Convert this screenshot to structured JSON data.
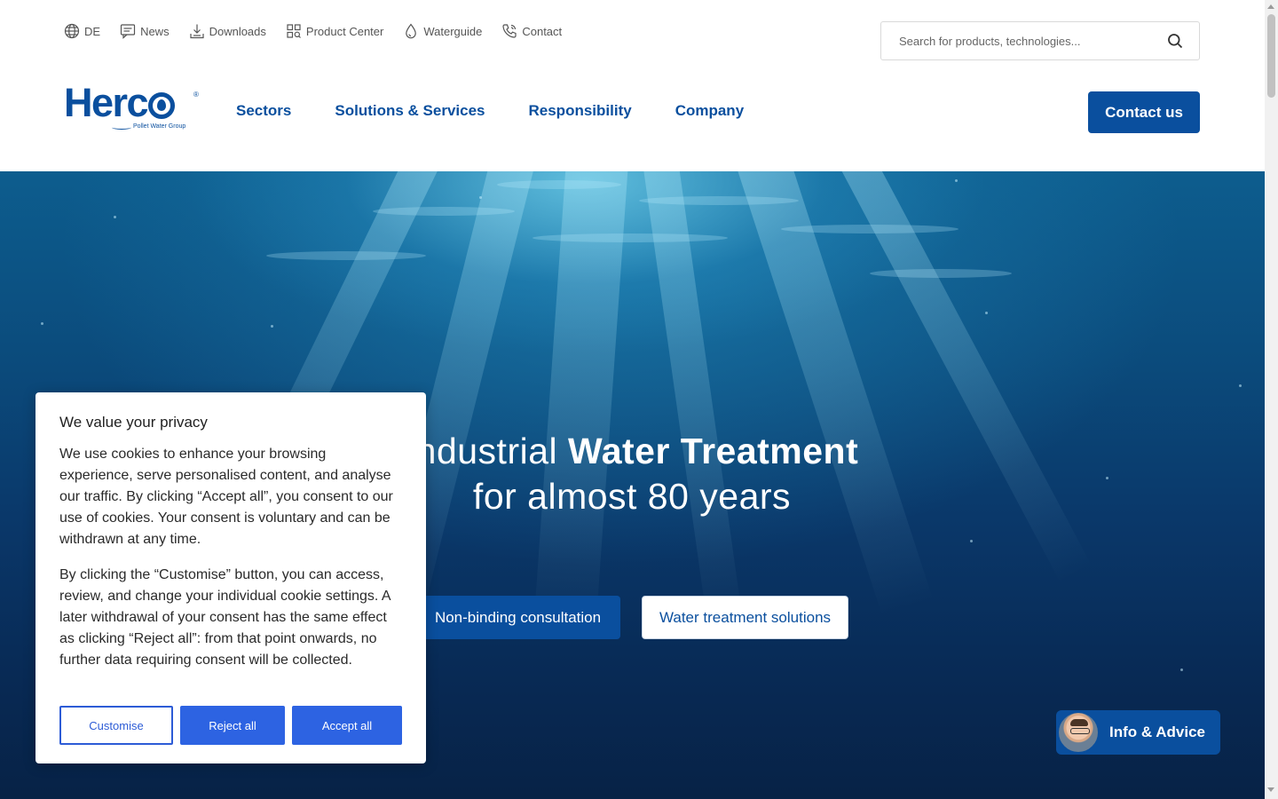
{
  "utility_nav": [
    {
      "label": "DE",
      "icon": "globe-icon"
    },
    {
      "label": "News",
      "icon": "chat-icon"
    },
    {
      "label": "Downloads",
      "icon": "download-icon"
    },
    {
      "label": "Product Center",
      "icon": "grid-search-icon"
    },
    {
      "label": "Waterguide",
      "icon": "water-drop-icon"
    },
    {
      "label": "Contact",
      "icon": "phone-icon"
    }
  ],
  "search": {
    "placeholder": "Search for products, technologies..."
  },
  "logo": {
    "word": "Herc",
    "tagline": "Pollet Water Group",
    "registered": "®"
  },
  "main_nav": [
    "Sectors",
    "Solutions & Services",
    "Responsibility",
    "Company"
  ],
  "contact_button": "Contact us",
  "hero": {
    "title_line1_prefix": "Industrial ",
    "title_line1_bold": "Water Treatment",
    "title_line2": "for almost 80 years",
    "primary_button": "Non-binding consultation",
    "secondary_button": "Water treatment solutions"
  },
  "info_widget": {
    "label": "Info & Advice"
  },
  "cookie_banner": {
    "title": "We value your privacy",
    "paragraph1": "We use cookies to enhance your browsing experience, serve personalised content, and analyse our traffic. By clicking “Accept all”, you consent to our use of cookies. Your consent is voluntary and can be withdrawn at any time.",
    "paragraph2": "By clicking the “Customise” button, you can access, review, and change your individual cookie settings. A later withdrawal of your consent has the same effect as clicking “Reject all”: from that point onwards, no further data requiring consent will be collected.",
    "customise": "Customise",
    "reject": "Reject all",
    "accept": "Accept all"
  },
  "colors": {
    "brand_blue": "#0a4f9e",
    "consent_blue": "#2d63e2",
    "hero_deep": "#072246"
  }
}
